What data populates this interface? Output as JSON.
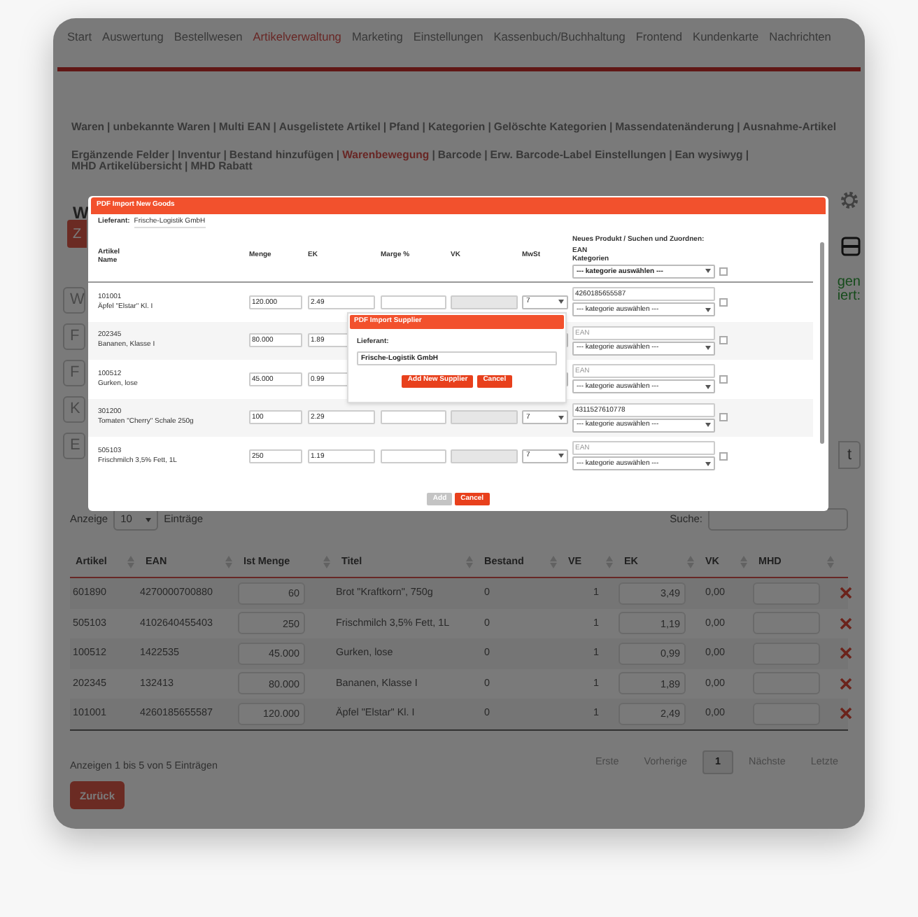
{
  "nav": [
    {
      "label": "Start",
      "selected": false
    },
    {
      "label": "Auswertung",
      "selected": false
    },
    {
      "label": "Bestellwesen",
      "selected": false
    },
    {
      "label": "Artikelverwaltung",
      "selected": true
    },
    {
      "label": "Marketing",
      "selected": false
    },
    {
      "label": "Einstellungen",
      "selected": false
    },
    {
      "label": "Kassenbuch/Buchhaltung",
      "selected": false
    },
    {
      "label": "Frontend",
      "selected": false
    },
    {
      "label": "Kundenkarte",
      "selected": false
    },
    {
      "label": "Nachrichten",
      "selected": false
    }
  ],
  "submenu": {
    "separator": "|",
    "rows": [
      {
        "trailing": false,
        "items": [
          {
            "label": "Waren",
            "selected": false
          },
          {
            "label": "unbekannte Waren",
            "selected": false
          },
          {
            "label": "Multi EAN",
            "selected": false
          },
          {
            "label": "Ausgelistete Artikel",
            "selected": false
          },
          {
            "label": "Pfand",
            "selected": false
          },
          {
            "label": "Kategorien",
            "selected": false
          },
          {
            "label": "Gelöschte Kategorien",
            "selected": false
          },
          {
            "label": "Massendatenänderung",
            "selected": false
          },
          {
            "label": "Ausnahme-Artikel",
            "selected": false
          }
        ]
      },
      {
        "trailing": true,
        "items": [
          {
            "label": "Ergänzende Felder",
            "selected": false
          },
          {
            "label": "Inventur",
            "selected": false
          },
          {
            "label": "Bestand hinzufügen",
            "selected": false
          },
          {
            "label": "Warenbewegung",
            "selected": true
          },
          {
            "label": "Barcode",
            "selected": false
          },
          {
            "label": "Erw. Barcode-Label Einstellungen",
            "selected": false
          },
          {
            "label": "Ean wysiwyg",
            "selected": false
          }
        ]
      },
      {
        "trailing": false,
        "items": [
          {
            "label": "MHD Artikelübersicht",
            "selected": false
          },
          {
            "label": "MHD Rabatt",
            "selected": false
          }
        ]
      }
    ]
  },
  "left_fragments": [
    {
      "kind": "heading",
      "text": "W"
    },
    {
      "kind": "button",
      "text": "Z"
    },
    {
      "kind": "field",
      "text": "W"
    },
    {
      "kind": "field",
      "text": "F"
    },
    {
      "kind": "field",
      "text": "F"
    },
    {
      "kind": "field",
      "text": "K"
    },
    {
      "kind": "field",
      "text": "E"
    }
  ],
  "right_fragments": [
    {
      "kind": "gear"
    },
    {
      "kind": "printer"
    },
    {
      "kind": "note",
      "text": "gen"
    },
    {
      "kind": "note",
      "text": "iert:"
    },
    {
      "kind": "button",
      "text": "t"
    }
  ],
  "length_control": {
    "label": "Anzeige",
    "value": "10",
    "suffix": "Einträge"
  },
  "search": {
    "label": "Suche:"
  },
  "table": {
    "columns": [
      "Artikel",
      "EAN",
      "Ist Menge",
      "Titel",
      "Bestand",
      "VE",
      "EK",
      "VK",
      "MHD"
    ],
    "rows": [
      {
        "artikel": "601890",
        "ean": "4270000700880",
        "menge": "60",
        "titel": "Brot \"Kraftkorn\", 750g",
        "bestand": "0",
        "ve": "1",
        "ek": "3,49",
        "vk": "0,00"
      },
      {
        "artikel": "505103",
        "ean": "4102640455403",
        "menge": "250",
        "titel": "Frischmilch 3,5% Fett, 1L",
        "bestand": "0",
        "ve": "1",
        "ek": "1,19",
        "vk": "0,00"
      },
      {
        "artikel": "100512",
        "ean": "1422535",
        "menge": "45.000",
        "titel": "Gurken, lose",
        "bestand": "0",
        "ve": "1",
        "ek": "0,99",
        "vk": "0,00"
      },
      {
        "artikel": "202345",
        "ean": "132413",
        "menge": "80.000",
        "titel": "Bananen, Klasse I",
        "bestand": "0",
        "ve": "1",
        "ek": "1,89",
        "vk": "0,00"
      },
      {
        "artikel": "101001",
        "ean": "4260185655587",
        "menge": "120.000",
        "titel": "Äpfel \"Elstar\" Kl. I",
        "bestand": "0",
        "ve": "1",
        "ek": "2,49",
        "vk": "0,00"
      }
    ]
  },
  "info": "Anzeigen 1 bis 5 von 5 Einträgen",
  "pagination": [
    {
      "label": "Erste",
      "selected": false
    },
    {
      "label": "Vorherige",
      "selected": false
    },
    {
      "label": "1",
      "selected": true
    },
    {
      "label": "Nächste",
      "selected": false
    },
    {
      "label": "Letzte",
      "selected": false
    }
  ],
  "back_button": "Zurück",
  "modal": {
    "title": "PDF Import New Goods",
    "supplier_label": "Lieferant:",
    "supplier": "Frische-Logistik GmbH",
    "columns": {
      "artikel": "Artikel",
      "name": "Name",
      "menge": "Menge",
      "ek": "EK",
      "marge": "Marge %",
      "vk": "VK",
      "mwst": "MwSt",
      "assign": "Neues Produkt / Suchen und Zuordnen:",
      "ean": "EAN",
      "kategorie": "Kategorien"
    },
    "header_category": "--- kategorie auswählen ---",
    "header_checked": false,
    "rows": [
      {
        "artikel": "101001",
        "name": "Äpfel \"Elstar\" Kl. I",
        "menge": "120.000",
        "ek": "2.49",
        "mwst": "7",
        "ean": "4260185655587",
        "category": "--- kategorie auswählen ---",
        "checked": false
      },
      {
        "artikel": "202345",
        "name": "Bananen, Klasse I",
        "menge": "80.000",
        "ek": "1.89",
        "ean_placeholder": "EAN",
        "category": "--- kategorie auswählen ---",
        "checked": false
      },
      {
        "artikel": "100512",
        "name": "Gurken, lose",
        "menge": "45.000",
        "ek": "0.99",
        "ean_placeholder": "EAN",
        "category": "--- kategorie auswählen ---",
        "checked": false
      },
      {
        "artikel": "301200",
        "name": "Tomaten \"Cherry\" Schale 250g",
        "menge": "100",
        "ek": "2.29",
        "mwst": "7",
        "ean": "4311527610778",
        "category": "--- kategorie auswählen ---",
        "checked": false
      },
      {
        "artikel": "505103",
        "name": "Frischmilch 3,5% Fett, 1L",
        "menge": "250",
        "ek": "1.19",
        "mwst": "7",
        "ean_placeholder": "EAN",
        "category": "--- kategorie auswählen ---",
        "checked": false
      }
    ],
    "buttons": [
      {
        "label": "Add",
        "disabled": true
      },
      {
        "label": "Cancel",
        "disabled": false
      }
    ],
    "supplier_dialog": {
      "title": "PDF Import Supplier",
      "label": "Lieferant:",
      "value": "Frische-Logistik GmbH",
      "buttons": [
        "Add New Supplier",
        "Cancel"
      ]
    }
  }
}
